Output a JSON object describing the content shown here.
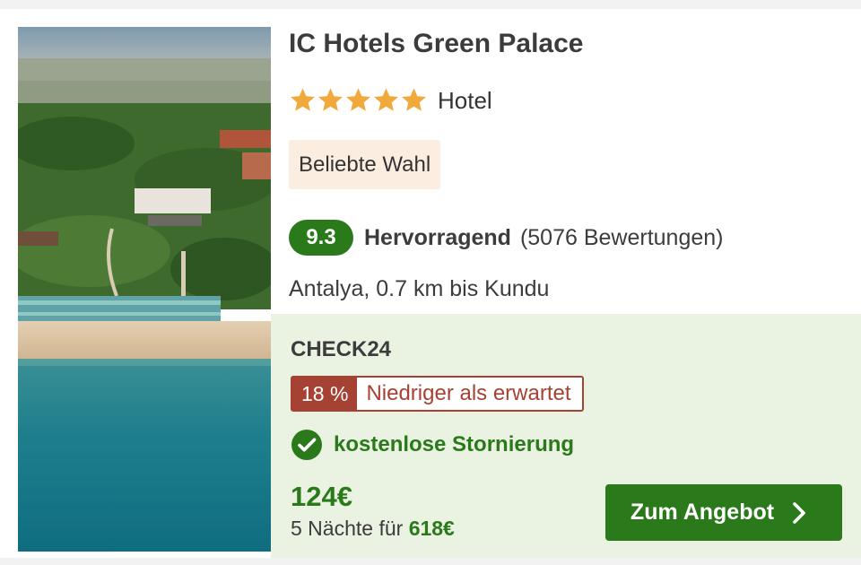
{
  "hotel": {
    "name": "IC Hotels Green Palace",
    "stars": 5,
    "type": "Hotel",
    "badge": "Beliebte Wahl",
    "score": "9.3",
    "rating_label": "Hervorragend",
    "review_count": "(5076 Bewertungen)",
    "location": "Antalya, 0.7 km bis Kundu",
    "photo_icon": "aerial-resort-photo"
  },
  "offer": {
    "provider": "CHECK24",
    "discount_percent": "18 %",
    "discount_text": "Niedriger als erwartet",
    "cancellation": "kostenlose Stornierung",
    "price_per_night": "124€",
    "nights_prefix": "5 Nächte für",
    "total_price": "618€",
    "cta_label": "Zum Angebot"
  },
  "colors": {
    "accent_green": "#2a7a1c",
    "deal_red": "#a64234",
    "star_gold": "#f2a93b",
    "badge_bg": "#fbeee1",
    "offer_bg": "#eaf2e2"
  }
}
